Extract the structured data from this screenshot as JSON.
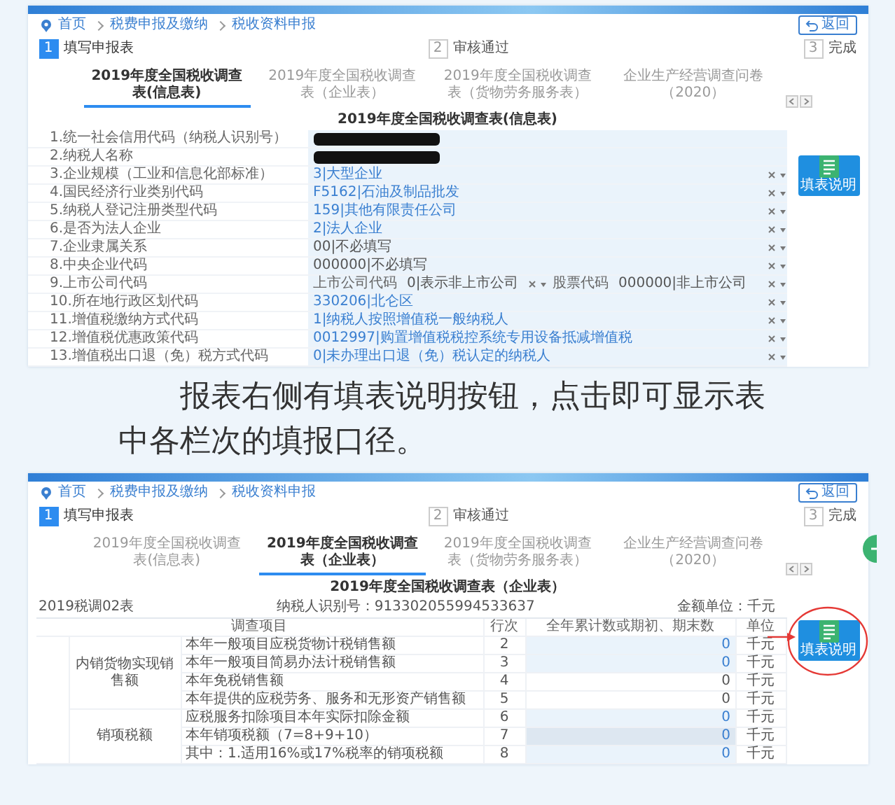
{
  "screenshot_1": {
    "kind": "info_form",
    "breadcrumb": [
      "首页",
      "税费申报及缴纳",
      "税收资料申报"
    ],
    "back_button": "返回",
    "steps": [
      {
        "number": "1",
        "label": "填写申报表",
        "selected": true
      },
      {
        "number": "2",
        "label": "审核通过",
        "selected": false
      },
      {
        "number": "3",
        "label": "完成",
        "selected": false
      }
    ],
    "tabs": [
      {
        "label": "2019年度全国税收调查表(信息表)",
        "selected": true
      },
      {
        "label": "2019年度全国税收调查表（企业表）",
        "selected": false
      },
      {
        "label": "2019年度全国税收调查表（货物劳务服务表）",
        "selected": false
      },
      {
        "label": "企业生产经营调查问卷（2020）",
        "selected": false
      }
    ],
    "form_title": "2019年度全国税收调查表(信息表)",
    "help_button": "填表说明",
    "rows": [
      {
        "kind": "redacted",
        "label": "1.统一社会信用代码（纳税人识别号）"
      },
      {
        "kind": "redacted",
        "label": "2.纳税人名称"
      },
      {
        "kind": "select",
        "label": "3.企业规模（工业和信息化部标准）",
        "value": "3|大型企业"
      },
      {
        "kind": "select",
        "label": "4.国民经济行业类别代码",
        "value": "F5162|石油及制品批发"
      },
      {
        "kind": "select",
        "label": "5.纳税人登记注册类型代码",
        "value": "159|其他有限责任公司"
      },
      {
        "kind": "select",
        "label": "6.是否为法人企业",
        "value": "2|法人企业"
      },
      {
        "kind": "text",
        "label": "7.企业隶属关系",
        "value": "00|不必填写"
      },
      {
        "kind": "text",
        "label": "8.中央企业代码",
        "value": "000000|不必填写"
      },
      {
        "kind": "pair",
        "label": "9.上市公司代码",
        "fields": [
          {
            "label": "上市公司代码",
            "value": "0|表示非上市公司"
          },
          {
            "label": "股票代码",
            "value": "000000|非上市公司"
          }
        ]
      },
      {
        "kind": "select",
        "label": "10.所在地行政区划代码",
        "value": "330206|北仑区"
      },
      {
        "kind": "select",
        "label": "11.增值税缴纳方式代码",
        "value": "1|纳税人按照增值税一般纳税人"
      },
      {
        "kind": "select",
        "label": "12.增值税优惠政策代码",
        "value": "0012997|购置增值税税控系统专用设备抵减增值税"
      },
      {
        "kind": "select",
        "label": "13.增值税出口退（免）税方式代码",
        "value": "0|未办理出口退（免）税认定的纳税人"
      }
    ]
  },
  "paragraph": "报表右侧有填表说明按钮，点击即可显示表中各栏次的填报口径。",
  "screenshot_2": {
    "kind": "survey_table",
    "breadcrumb": [
      "首页",
      "税费申报及缴纳",
      "税收资料申报"
    ],
    "back_button": "返回",
    "steps": [
      {
        "number": "1",
        "label": "填写申报表",
        "selected": true
      },
      {
        "number": "2",
        "label": "审核通过",
        "selected": false
      },
      {
        "number": "3",
        "label": "完成",
        "selected": false
      }
    ],
    "tabs": [
      {
        "label": "2019年度全国税收调查表(信息表)",
        "selected": false
      },
      {
        "label": "2019年度全国税收调查表（企业表）",
        "selected": true
      },
      {
        "label": "2019年度全国税收调查表（货物劳务服务表）",
        "selected": false
      },
      {
        "label": "企业生产经营调查问卷（2020）",
        "selected": false
      }
    ],
    "form_title": "2019年度全国税收调查表（企业表）",
    "help_button": "填表说明",
    "table_code": "2019税调02表",
    "taxpayer_id": "纳税人识别号：913302055994533637",
    "amount_unit": "金额单位：千元",
    "columns": [
      "调查项目",
      "行次",
      "全年累计数或期初、期末数",
      "单位"
    ],
    "groups": [
      {
        "label": "内销货物实现销售额",
        "rows": [
          {
            "item": "本年一般项目应税货物计税销售额",
            "line": "2",
            "value": "0",
            "unit": "千元",
            "kind": "input"
          },
          {
            "item": "本年一般项目简易办法计税销售额",
            "line": "3",
            "value": "0",
            "unit": "千元",
            "kind": "input"
          },
          {
            "item": "本年免税销售额",
            "line": "4",
            "value": "0",
            "unit": "千元",
            "kind": "plain"
          },
          {
            "item": "本年提供的应税劳务、服务和无形资产销售额",
            "line": "5",
            "value": "0",
            "unit": "千元",
            "kind": "plain"
          }
        ]
      },
      {
        "label": "销项税额",
        "rows": [
          {
            "item": "应税服务扣除项目本年实际扣除金额",
            "line": "6",
            "value": "0",
            "unit": "千元",
            "kind": "input"
          },
          {
            "item": "本年销项税额（7=8+9+10）",
            "line": "7",
            "value": "0",
            "unit": "千元",
            "kind": "computed"
          },
          {
            "item": "其中：1.适用16%或17%税率的销项税额",
            "line": "8",
            "value": "0",
            "unit": "千元",
            "kind": "input"
          }
        ]
      }
    ]
  }
}
